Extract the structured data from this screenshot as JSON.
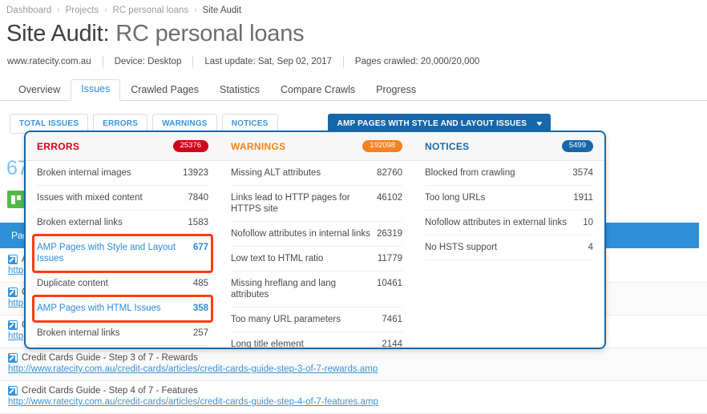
{
  "breadcrumb": {
    "items": [
      "Dashboard",
      "Projects",
      "RC personal loans",
      "Site Audit"
    ],
    "separator": "›"
  },
  "header": {
    "title_prefix": "Site Audit:",
    "title_project": "RC personal loans",
    "domain": "www.ratecity.com.au",
    "device": "Device: Desktop",
    "last_update": "Last update: Sat, Sep 02, 2017",
    "pages_crawled": "Pages crawled: 20,000/20,000"
  },
  "tabs": [
    {
      "label": "Overview",
      "active": false
    },
    {
      "label": "Issues",
      "active": true
    },
    {
      "label": "Crawled Pages",
      "active": false
    },
    {
      "label": "Statistics",
      "active": false
    },
    {
      "label": "Compare Crawls",
      "active": false
    },
    {
      "label": "Progress",
      "active": false
    }
  ],
  "filters": [
    {
      "label": "TOTAL ISSUES",
      "selected": false
    },
    {
      "label": "ERRORS",
      "selected": false
    },
    {
      "label": "WARNINGS",
      "selected": false
    },
    {
      "label": "NOTICES",
      "selected": false
    }
  ],
  "issue_select": {
    "label": "AMP PAGES WITH STYLE AND LAYOUT ISSUES",
    "caret": "▼"
  },
  "background": {
    "count": "67",
    "results_bar_label": "Pag",
    "rows": [
      {
        "title": "A",
        "url": "http",
        "alt": false
      },
      {
        "title": "C",
        "url": "http",
        "alt": true
      },
      {
        "title": "C",
        "url": "http",
        "alt": false
      },
      {
        "title": "Credit Cards Guide - Step 3 of 7 - Rewards",
        "url": "http://www.ratecity.com.au/credit-cards/articles/credit-cards-guide-step-3-of-7-rewards.amp",
        "alt": true
      },
      {
        "title": "Credit Cards Guide - Step 4 of 7 - Features",
        "url": "http://www.ratecity.com.au/credit-cards/articles/credit-cards-guide-step-4-of-7-features.amp",
        "alt": false
      }
    ]
  },
  "panel": {
    "columns": [
      {
        "key": "errors",
        "title": "ERRORS",
        "badge": "25376",
        "badge_color": "#d0021b",
        "title_color": "#d0021b",
        "items": [
          {
            "name": "Broken internal images",
            "value": "13923",
            "link": false,
            "highlight": false
          },
          {
            "name": "Issues with mixed content",
            "value": "7840",
            "link": false,
            "highlight": false
          },
          {
            "name": "Broken external links",
            "value": "1583",
            "link": false,
            "highlight": false
          },
          {
            "name": "AMP Pages with Style and Layout Issues",
            "value": "677",
            "link": true,
            "highlight": true
          },
          {
            "name": "Duplicate content",
            "value": "485",
            "link": false,
            "highlight": false
          },
          {
            "name": "AMP Pages with HTML Issues",
            "value": "358",
            "link": true,
            "highlight": true
          },
          {
            "name": "Broken internal links",
            "value": "257",
            "link": false,
            "highlight": false
          }
        ]
      },
      {
        "key": "warnings",
        "title": "WARNINGS",
        "badge": "192098",
        "badge_color": "#f5821f",
        "title_color": "#f5821f",
        "items": [
          {
            "name": "Missing ALT attributes",
            "value": "82760",
            "link": false,
            "highlight": false
          },
          {
            "name": "Links lead to HTTP pages for HTTPS site",
            "value": "46102",
            "link": false,
            "highlight": false
          },
          {
            "name": "Nofollow attributes in internal links",
            "value": "26319",
            "link": false,
            "highlight": false
          },
          {
            "name": "Low text to HTML ratio",
            "value": "11779",
            "link": false,
            "highlight": false
          },
          {
            "name": "Missing hreflang and lang attributes",
            "value": "10461",
            "link": false,
            "highlight": false
          },
          {
            "name": "Too many URL parameters",
            "value": "7461",
            "link": false,
            "highlight": false
          },
          {
            "name": "Long title element",
            "value": "2144",
            "link": false,
            "highlight": false
          }
        ]
      },
      {
        "key": "notices",
        "title": "NOTICES",
        "badge": "5499",
        "badge_color": "#1668ab",
        "title_color": "#1668ab",
        "items": [
          {
            "name": "Blocked from crawling",
            "value": "3574",
            "link": false,
            "highlight": false
          },
          {
            "name": "Too long URLs",
            "value": "1911",
            "link": false,
            "highlight": false
          },
          {
            "name": "Nofollow attributes in external links",
            "value": "10",
            "link": false,
            "highlight": false
          },
          {
            "name": "No HSTS support",
            "value": "4",
            "link": false,
            "highlight": false
          }
        ]
      }
    ]
  },
  "colors": {
    "accent_blue": "#1668ab",
    "link_blue": "#3a93d8",
    "error_red": "#d0021b",
    "warning_orange": "#f5821f",
    "highlight_red": "#ff3b15"
  }
}
